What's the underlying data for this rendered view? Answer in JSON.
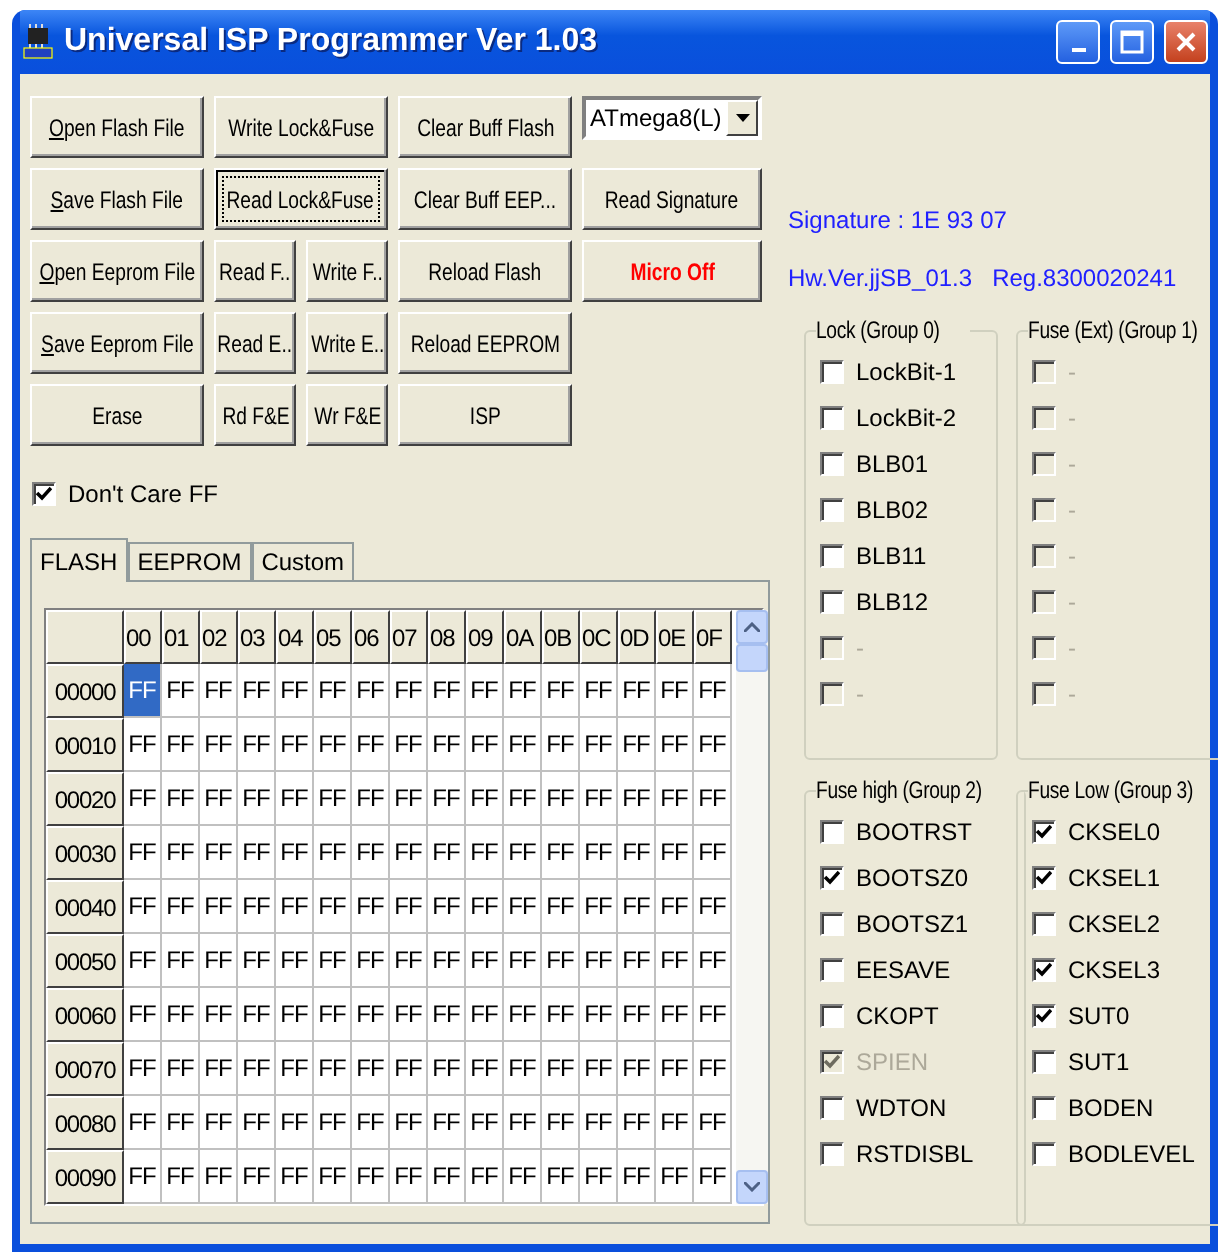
{
  "window": {
    "title": "Universal ISP Programmer Ver 1.03"
  },
  "button_rows": [
    [
      {
        "kind": "wide",
        "label": "Open Flash File",
        "mnemonic_first": true,
        "focused": false
      },
      {
        "kind": "wide",
        "label": "Write Lock&Fuse",
        "mnemonic_first": false,
        "focused": false
      },
      {
        "kind": "wide",
        "label": "Clear Buff Flash",
        "mnemonic_first": false,
        "focused": false
      },
      {
        "kind": "select",
        "value": "ATmega8(L)"
      }
    ],
    [
      {
        "kind": "wide",
        "label": "Save Flash File",
        "mnemonic_first": true,
        "focused": false
      },
      {
        "kind": "wide",
        "label": "Read Lock&Fuse",
        "mnemonic_first": false,
        "focused": true
      },
      {
        "kind": "wide",
        "label": "Clear Buff EEP...",
        "mnemonic_first": false,
        "focused": false
      },
      {
        "kind": "side",
        "label": "Read Signature",
        "mnemonic_first": false,
        "focused": false
      }
    ],
    [
      {
        "kind": "wide",
        "label": "Open Eeprom File",
        "mnemonic_first": true,
        "focused": false
      },
      {
        "kind": "half",
        "label": "Read F..",
        "mnemonic_first": false,
        "focused": false
      },
      {
        "kind": "half",
        "label": "Write F..",
        "mnemonic_first": false,
        "focused": false
      },
      {
        "kind": "wide",
        "label": "Reload Flash",
        "mnemonic_first": false,
        "focused": false
      },
      {
        "kind": "status",
        "label": "Micro Off"
      }
    ],
    [
      {
        "kind": "wide",
        "label": "Save Eeprom File",
        "mnemonic_first": true,
        "focused": false
      },
      {
        "kind": "half",
        "label": "Read E..",
        "mnemonic_first": false,
        "focused": false
      },
      {
        "kind": "half",
        "label": "Write E..",
        "mnemonic_first": false,
        "focused": false
      },
      {
        "kind": "wide",
        "label": "Reload EEPROM",
        "mnemonic_first": false,
        "focused": false
      }
    ],
    [
      {
        "kind": "wide",
        "label": "Erase",
        "mnemonic_first": false,
        "focused": false
      },
      {
        "kind": "half",
        "label": "Rd F&E",
        "mnemonic_first": false,
        "focused": false
      },
      {
        "kind": "half",
        "label": "Wr F&E",
        "mnemonic_first": false,
        "focused": false
      },
      {
        "kind": "wide",
        "label": "ISP",
        "mnemonic_first": false,
        "focused": false
      }
    ]
  ],
  "dont_care": {
    "label": "Don't Care FF",
    "checked": true
  },
  "tabs": [
    {
      "label": "FLASH",
      "selected": true
    },
    {
      "label": "EEPROM",
      "selected": false
    },
    {
      "label": "Custom",
      "selected": false
    }
  ],
  "table": {
    "columns": [
      "00",
      "01",
      "02",
      "03",
      "04",
      "05",
      "06",
      "07",
      "08",
      "09",
      "0A",
      "0B",
      "0C",
      "0D",
      "0E",
      "0F"
    ],
    "rows": [
      {
        "address": "00000",
        "cells": [
          {
            "value": "FF",
            "selected": true
          },
          {
            "value": "FF",
            "selected": false
          },
          {
            "value": "FF",
            "selected": false
          },
          {
            "value": "FF",
            "selected": false
          },
          {
            "value": "FF",
            "selected": false
          },
          {
            "value": "FF",
            "selected": false
          },
          {
            "value": "FF",
            "selected": false
          },
          {
            "value": "FF",
            "selected": false
          },
          {
            "value": "FF",
            "selected": false
          },
          {
            "value": "FF",
            "selected": false
          },
          {
            "value": "FF",
            "selected": false
          },
          {
            "value": "FF",
            "selected": false
          },
          {
            "value": "FF",
            "selected": false
          },
          {
            "value": "FF",
            "selected": false
          },
          {
            "value": "FF",
            "selected": false
          },
          {
            "value": "FF",
            "selected": false
          }
        ]
      },
      {
        "address": "00010",
        "cells": [
          {
            "value": "FF",
            "selected": false
          },
          {
            "value": "FF",
            "selected": false
          },
          {
            "value": "FF",
            "selected": false
          },
          {
            "value": "FF",
            "selected": false
          },
          {
            "value": "FF",
            "selected": false
          },
          {
            "value": "FF",
            "selected": false
          },
          {
            "value": "FF",
            "selected": false
          },
          {
            "value": "FF",
            "selected": false
          },
          {
            "value": "FF",
            "selected": false
          },
          {
            "value": "FF",
            "selected": false
          },
          {
            "value": "FF",
            "selected": false
          },
          {
            "value": "FF",
            "selected": false
          },
          {
            "value": "FF",
            "selected": false
          },
          {
            "value": "FF",
            "selected": false
          },
          {
            "value": "FF",
            "selected": false
          },
          {
            "value": "FF",
            "selected": false
          }
        ]
      },
      {
        "address": "00020",
        "cells": [
          {
            "value": "FF",
            "selected": false
          },
          {
            "value": "FF",
            "selected": false
          },
          {
            "value": "FF",
            "selected": false
          },
          {
            "value": "FF",
            "selected": false
          },
          {
            "value": "FF",
            "selected": false
          },
          {
            "value": "FF",
            "selected": false
          },
          {
            "value": "FF",
            "selected": false
          },
          {
            "value": "FF",
            "selected": false
          },
          {
            "value": "FF",
            "selected": false
          },
          {
            "value": "FF",
            "selected": false
          },
          {
            "value": "FF",
            "selected": false
          },
          {
            "value": "FF",
            "selected": false
          },
          {
            "value": "FF",
            "selected": false
          },
          {
            "value": "FF",
            "selected": false
          },
          {
            "value": "FF",
            "selected": false
          },
          {
            "value": "FF",
            "selected": false
          }
        ]
      },
      {
        "address": "00030",
        "cells": [
          {
            "value": "FF",
            "selected": false
          },
          {
            "value": "FF",
            "selected": false
          },
          {
            "value": "FF",
            "selected": false
          },
          {
            "value": "FF",
            "selected": false
          },
          {
            "value": "FF",
            "selected": false
          },
          {
            "value": "FF",
            "selected": false
          },
          {
            "value": "FF",
            "selected": false
          },
          {
            "value": "FF",
            "selected": false
          },
          {
            "value": "FF",
            "selected": false
          },
          {
            "value": "FF",
            "selected": false
          },
          {
            "value": "FF",
            "selected": false
          },
          {
            "value": "FF",
            "selected": false
          },
          {
            "value": "FF",
            "selected": false
          },
          {
            "value": "FF",
            "selected": false
          },
          {
            "value": "FF",
            "selected": false
          },
          {
            "value": "FF",
            "selected": false
          }
        ]
      },
      {
        "address": "00040",
        "cells": [
          {
            "value": "FF",
            "selected": false
          },
          {
            "value": "FF",
            "selected": false
          },
          {
            "value": "FF",
            "selected": false
          },
          {
            "value": "FF",
            "selected": false
          },
          {
            "value": "FF",
            "selected": false
          },
          {
            "value": "FF",
            "selected": false
          },
          {
            "value": "FF",
            "selected": false
          },
          {
            "value": "FF",
            "selected": false
          },
          {
            "value": "FF",
            "selected": false
          },
          {
            "value": "FF",
            "selected": false
          },
          {
            "value": "FF",
            "selected": false
          },
          {
            "value": "FF",
            "selected": false
          },
          {
            "value": "FF",
            "selected": false
          },
          {
            "value": "FF",
            "selected": false
          },
          {
            "value": "FF",
            "selected": false
          },
          {
            "value": "FF",
            "selected": false
          }
        ]
      },
      {
        "address": "00050",
        "cells": [
          {
            "value": "FF",
            "selected": false
          },
          {
            "value": "FF",
            "selected": false
          },
          {
            "value": "FF",
            "selected": false
          },
          {
            "value": "FF",
            "selected": false
          },
          {
            "value": "FF",
            "selected": false
          },
          {
            "value": "FF",
            "selected": false
          },
          {
            "value": "FF",
            "selected": false
          },
          {
            "value": "FF",
            "selected": false
          },
          {
            "value": "FF",
            "selected": false
          },
          {
            "value": "FF",
            "selected": false
          },
          {
            "value": "FF",
            "selected": false
          },
          {
            "value": "FF",
            "selected": false
          },
          {
            "value": "FF",
            "selected": false
          },
          {
            "value": "FF",
            "selected": false
          },
          {
            "value": "FF",
            "selected": false
          },
          {
            "value": "FF",
            "selected": false
          }
        ]
      },
      {
        "address": "00060",
        "cells": [
          {
            "value": "FF",
            "selected": false
          },
          {
            "value": "FF",
            "selected": false
          },
          {
            "value": "FF",
            "selected": false
          },
          {
            "value": "FF",
            "selected": false
          },
          {
            "value": "FF",
            "selected": false
          },
          {
            "value": "FF",
            "selected": false
          },
          {
            "value": "FF",
            "selected": false
          },
          {
            "value": "FF",
            "selected": false
          },
          {
            "value": "FF",
            "selected": false
          },
          {
            "value": "FF",
            "selected": false
          },
          {
            "value": "FF",
            "selected": false
          },
          {
            "value": "FF",
            "selected": false
          },
          {
            "value": "FF",
            "selected": false
          },
          {
            "value": "FF",
            "selected": false
          },
          {
            "value": "FF",
            "selected": false
          },
          {
            "value": "FF",
            "selected": false
          }
        ]
      },
      {
        "address": "00070",
        "cells": [
          {
            "value": "FF",
            "selected": false
          },
          {
            "value": "FF",
            "selected": false
          },
          {
            "value": "FF",
            "selected": false
          },
          {
            "value": "FF",
            "selected": false
          },
          {
            "value": "FF",
            "selected": false
          },
          {
            "value": "FF",
            "selected": false
          },
          {
            "value": "FF",
            "selected": false
          },
          {
            "value": "FF",
            "selected": false
          },
          {
            "value": "FF",
            "selected": false
          },
          {
            "value": "FF",
            "selected": false
          },
          {
            "value": "FF",
            "selected": false
          },
          {
            "value": "FF",
            "selected": false
          },
          {
            "value": "FF",
            "selected": false
          },
          {
            "value": "FF",
            "selected": false
          },
          {
            "value": "FF",
            "selected": false
          },
          {
            "value": "FF",
            "selected": false
          }
        ]
      },
      {
        "address": "00080",
        "cells": [
          {
            "value": "FF",
            "selected": false
          },
          {
            "value": "FF",
            "selected": false
          },
          {
            "value": "FF",
            "selected": false
          },
          {
            "value": "FF",
            "selected": false
          },
          {
            "value": "FF",
            "selected": false
          },
          {
            "value": "FF",
            "selected": false
          },
          {
            "value": "FF",
            "selected": false
          },
          {
            "value": "FF",
            "selected": false
          },
          {
            "value": "FF",
            "selected": false
          },
          {
            "value": "FF",
            "selected": false
          },
          {
            "value": "FF",
            "selected": false
          },
          {
            "value": "FF",
            "selected": false
          },
          {
            "value": "FF",
            "selected": false
          },
          {
            "value": "FF",
            "selected": false
          },
          {
            "value": "FF",
            "selected": false
          },
          {
            "value": "FF",
            "selected": false
          }
        ]
      },
      {
        "address": "00090",
        "cells": [
          {
            "value": "FF",
            "selected": false
          },
          {
            "value": "FF",
            "selected": false
          },
          {
            "value": "FF",
            "selected": false
          },
          {
            "value": "FF",
            "selected": false
          },
          {
            "value": "FF",
            "selected": false
          },
          {
            "value": "FF",
            "selected": false
          },
          {
            "value": "FF",
            "selected": false
          },
          {
            "value": "FF",
            "selected": false
          },
          {
            "value": "FF",
            "selected": false
          },
          {
            "value": "FF",
            "selected": false
          },
          {
            "value": "FF",
            "selected": false
          },
          {
            "value": "FF",
            "selected": false
          },
          {
            "value": "FF",
            "selected": false
          },
          {
            "value": "FF",
            "selected": false
          },
          {
            "value": "FF",
            "selected": false
          },
          {
            "value": "FF",
            "selected": false
          }
        ]
      }
    ]
  },
  "signature": "Signature : 1E 93 07",
  "hardware": [
    "Hw.Ver.jjSB_01.3",
    "Reg.8300020241"
  ],
  "groups": [
    {
      "title": "Lock (Group 0)",
      "items": [
        {
          "label": "LockBit-1",
          "checked": false,
          "disabled": false
        },
        {
          "label": "LockBit-2",
          "checked": false,
          "disabled": false
        },
        {
          "label": "BLB01",
          "checked": false,
          "disabled": false
        },
        {
          "label": "BLB02",
          "checked": false,
          "disabled": false
        },
        {
          "label": "BLB11",
          "checked": false,
          "disabled": false
        },
        {
          "label": "BLB12",
          "checked": false,
          "disabled": false
        },
        {
          "label": "-",
          "checked": false,
          "disabled": true
        },
        {
          "label": "-",
          "checked": false,
          "disabled": true
        }
      ]
    },
    {
      "title": "Fuse (Ext) (Group 1)",
      "items": [
        {
          "label": "-",
          "checked": false,
          "disabled": true
        },
        {
          "label": "-",
          "checked": false,
          "disabled": true
        },
        {
          "label": "-",
          "checked": false,
          "disabled": true
        },
        {
          "label": "-",
          "checked": false,
          "disabled": true
        },
        {
          "label": "-",
          "checked": false,
          "disabled": true
        },
        {
          "label": "-",
          "checked": false,
          "disabled": true
        },
        {
          "label": "-",
          "checked": false,
          "disabled": true
        },
        {
          "label": "-",
          "checked": false,
          "disabled": true
        }
      ]
    },
    {
      "title": "Fuse high (Group 2)",
      "items": [
        {
          "label": "BOOTRST",
          "checked": false,
          "disabled": false
        },
        {
          "label": "BOOTSZ0",
          "checked": true,
          "disabled": false
        },
        {
          "label": "BOOTSZ1",
          "checked": false,
          "disabled": false
        },
        {
          "label": "EESAVE",
          "checked": false,
          "disabled": false
        },
        {
          "label": "CKOPT",
          "checked": false,
          "disabled": false
        },
        {
          "label": "SPIEN",
          "checked": true,
          "disabled": true
        },
        {
          "label": "WDTON",
          "checked": false,
          "disabled": false
        },
        {
          "label": "RSTDISBL",
          "checked": false,
          "disabled": false
        }
      ]
    },
    {
      "title": "Fuse Low (Group 3)",
      "items": [
        {
          "label": "CKSEL0",
          "checked": true,
          "disabled": false
        },
        {
          "label": "CKSEL1",
          "checked": true,
          "disabled": false
        },
        {
          "label": "CKSEL2",
          "checked": false,
          "disabled": false
        },
        {
          "label": "CKSEL3",
          "checked": true,
          "disabled": false
        },
        {
          "label": "SUT0",
          "checked": true,
          "disabled": false
        },
        {
          "label": "SUT1",
          "checked": false,
          "disabled": false
        },
        {
          "label": "BODEN",
          "checked": false,
          "disabled": false
        },
        {
          "label": "BODLEVEL",
          "checked": false,
          "disabled": false
        }
      ]
    }
  ]
}
